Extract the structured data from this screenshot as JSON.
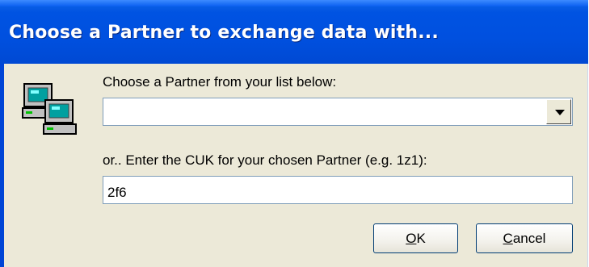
{
  "dialog": {
    "title": "Choose a Partner to exchange data with..."
  },
  "icon": "networked-computers-icon",
  "partner_list": {
    "label": "Choose a Partner from your list below:",
    "selected_value": ""
  },
  "cuk": {
    "label": "or.. Enter the CUK for your chosen Partner (e.g. 1z1):",
    "value": "2f6"
  },
  "buttons": {
    "ok": {
      "mnemonic": "O",
      "rest": "K"
    },
    "cancel": {
      "mnemonic": "C",
      "rest": "ancel"
    }
  }
}
